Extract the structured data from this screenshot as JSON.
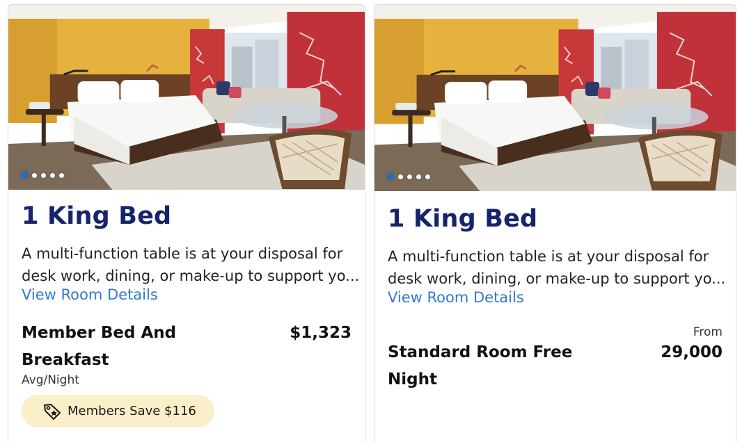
{
  "cards": [
    {
      "image_alt": "Hotel room with king bed",
      "carousel": {
        "active_index": 0,
        "count": 5
      },
      "title": "1 King Bed",
      "description_lines": [
        "A multi-function table is at your disposal for",
        "desk work, dining, or make-up to support yo..."
      ],
      "details_link": "View Room Details",
      "rate_name": "Member Bed And Breakfast",
      "price": "$1,323",
      "price_unit": "Avg/Night",
      "badge": {
        "icon": "tag-icon",
        "label": "Members Save $116"
      }
    },
    {
      "image_alt": "Hotel room with king bed",
      "carousel": {
        "active_index": 0,
        "count": 5
      },
      "title": "1 King Bed",
      "description_lines": [
        "A multi-function table is at your disposal for",
        "desk work, dining, or make-up to support yo..."
      ],
      "details_link": "View Room Details",
      "price_prefix": "From",
      "rate_name": "Standard Room Free Night",
      "price": "29,000"
    }
  ],
  "colors": {
    "title": "#15246b",
    "link": "#2f7ad0",
    "badge_bg": "#fbefc9",
    "dot_active": "#1f6fd1"
  }
}
